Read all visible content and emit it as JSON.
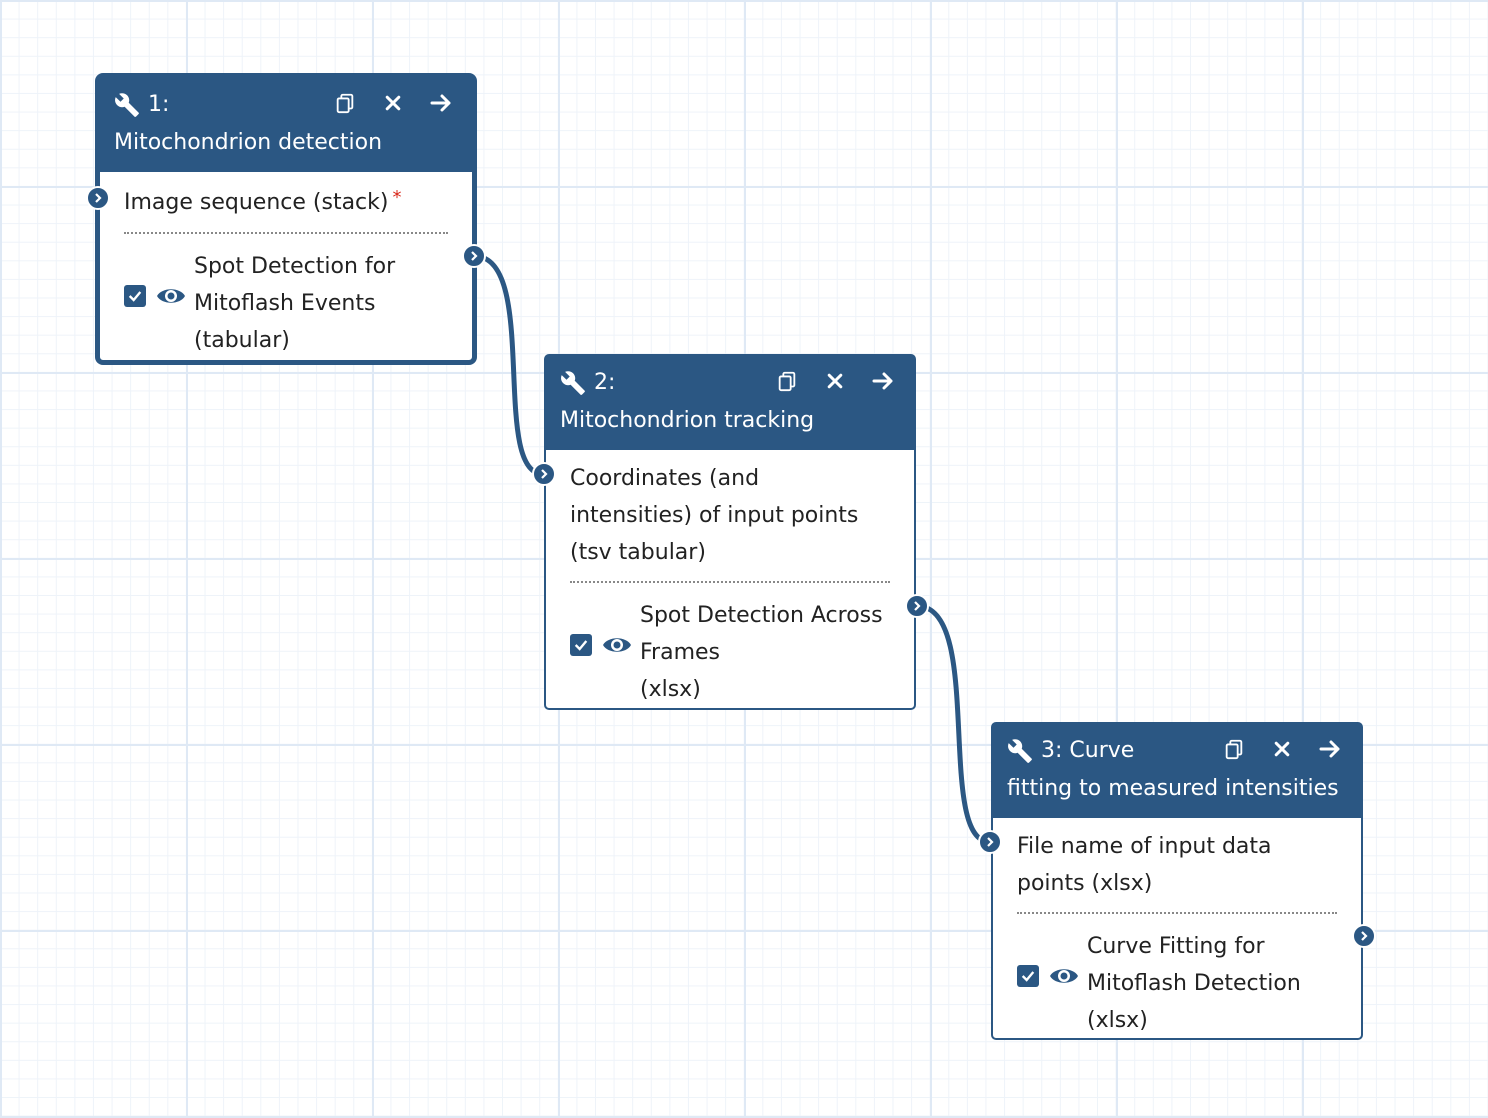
{
  "colors": {
    "node_header": "#2b5783",
    "required_marker": "#d9281b",
    "grid": "#dfe9f5"
  },
  "nodes": [
    {
      "id_label": "1:",
      "title": "Mitochondrion detection",
      "inputs": [
        {
          "label": "Image sequence (stack)",
          "required": "*"
        }
      ],
      "outputs": [
        {
          "label_lines": [
            "Spot Detection for",
            "Mitoflash Events",
            "(tabular)"
          ]
        }
      ],
      "icons": [
        "wrench-icon",
        "copy-icon",
        "close-icon",
        "arrow-right-icon"
      ]
    },
    {
      "id_label": "2:",
      "title": "Mitochondrion tracking",
      "inputs": [
        {
          "label_lines": [
            "Coordinates (and",
            "intensities) of input points",
            "(tsv tabular)"
          ]
        }
      ],
      "outputs": [
        {
          "label_lines": [
            "Spot Detection Across",
            "Frames",
            "(xlsx)"
          ]
        }
      ],
      "icons": [
        "wrench-icon",
        "copy-icon",
        "close-icon",
        "arrow-right-icon"
      ]
    },
    {
      "id_label": "3: Curve",
      "title": "fitting to measured intensities",
      "inputs": [
        {
          "label_lines": [
            "File name of input data",
            "points (xlsx)"
          ]
        }
      ],
      "outputs": [
        {
          "label_lines": [
            "Curve Fitting for",
            "Mitoflash Detection",
            "(xlsx)"
          ]
        }
      ],
      "icons": [
        "wrench-icon",
        "copy-icon",
        "close-icon",
        "arrow-right-icon"
      ]
    }
  ]
}
